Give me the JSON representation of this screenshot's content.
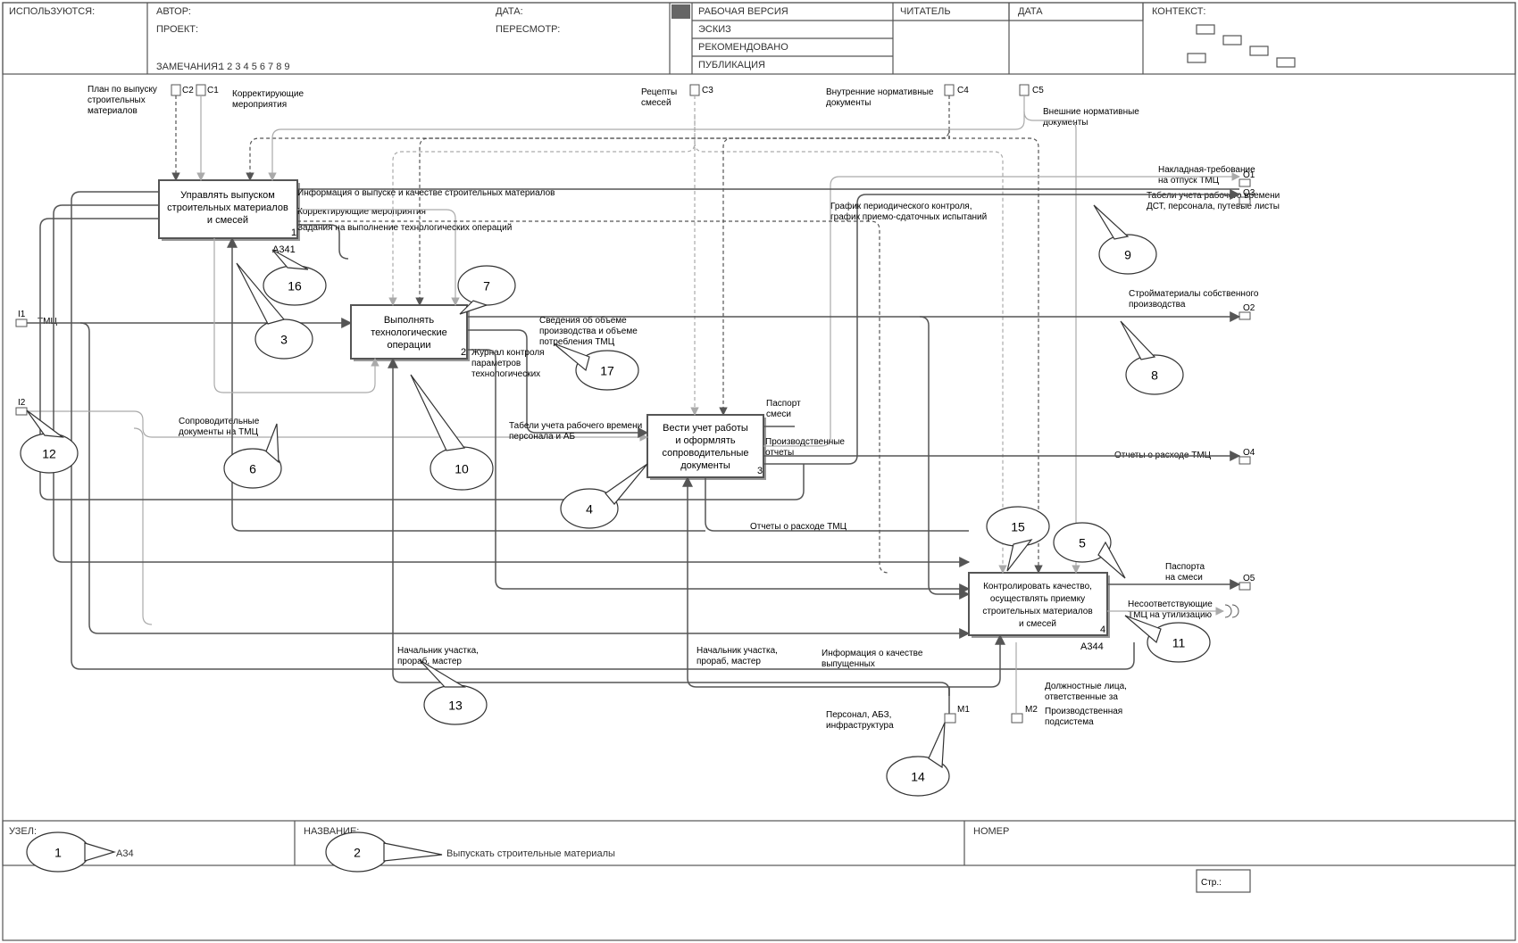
{
  "header": {
    "used": "ИСПОЛЬЗУЮТСЯ:",
    "author": "АВТОР:",
    "project": "ПРОЕКТ:",
    "date": "ДАТА:",
    "revision": "ПЕРЕСМОТР:",
    "notes": "ЗАМЕЧАНИЯ:",
    "noteNums": "1  2  3  4  5  6  7  8  9",
    "reader": "ЧИТАТЕЛЬ",
    "readerDate": "ДАТА",
    "context": "КОНТЕКСТ:",
    "rows": [
      "РАБОЧАЯ ВЕРСИЯ",
      "ЭСКИЗ",
      "РЕКОМЕНДОВАНО",
      "ПУБЛИКАЦИЯ"
    ]
  },
  "footer": {
    "node": "УЗЕЛ:",
    "nodeVal": "A34",
    "title": "НАЗВАНИЕ:",
    "titleVal": "Выпускать строительные материалы",
    "number": "НОМЕР",
    "page": "Стр.:"
  },
  "boxes": {
    "b1": {
      "l1": "Управлять выпуском",
      "l2": "строительных материалов",
      "l3": "и смесей",
      "num": "1",
      "code": "A341"
    },
    "b2": {
      "l1": "Выполнять",
      "l2": "технологические",
      "l3": "операции",
      "num": "2"
    },
    "b3": {
      "l1": "Вести учет работы",
      "l2": "и оформлять",
      "l3": "сопроводительные",
      "l4": "документы",
      "num": "3"
    },
    "b4": {
      "l1": "Контролировать качество,",
      "l2": "осуществлять приемку",
      "l3": "строительных материалов",
      "l4": "и смесей",
      "num": "4",
      "code": "A344"
    }
  },
  "controls": {
    "c1": "C1",
    "c2": "C2",
    "c3": "C3",
    "c4": "C4",
    "c5": "C5",
    "c1t": "Корректирующие",
    "c1t2": "мероприятия",
    "c2t": "План по выпуску",
    "c2t2": "строительных",
    "c2t3": "материалов",
    "c3t": "Рецепты",
    "c3t2": "смесей",
    "c4t": "Внутренние нормативные",
    "c4t2": "документы",
    "c5t": "Внешние нормативные",
    "c5t2": "документы"
  },
  "inputs": {
    "i1": "I1",
    "i1t": "ТМЦ",
    "i2": "I2"
  },
  "outputs": {
    "o1": "O1",
    "o1t": "Накладная-требование",
    "o1t2": "на отпуск ТМЦ",
    "o2": "O2",
    "o2t": "Стройматериалы собственного",
    "o2t2": "производства",
    "o3": "O3",
    "o3t": "Табели учета рабочего времени",
    "o3t2": "ДСТ, персонала, путевые листы",
    "o4": "O4",
    "o4t": "Отчеты о расходе ТМЦ",
    "o5": "O5",
    "o5t": "Паспорта",
    "o5t2": "на смеси"
  },
  "mech": {
    "m1": "M1",
    "m2": "M2",
    "m1t": "Персонал, АБЗ,",
    "m1t2": "инфраструктура",
    "m2t": "Должностные лица,",
    "m2t2": "ответственные за",
    "ps": "Производственная",
    "ps2": "подсистема"
  },
  "labels": {
    "l1": "Информация о выпуске и качестве строительных материалов",
    "l2": "Корректирующие мероприятия",
    "l3": "Задания на выполнение технологических операций",
    "l4": "Журнал контроля",
    "l4b": "параметров",
    "l4c": "технологических",
    "l5": "Сведения об объеме",
    "l5b": "производства и объеме",
    "l5c": "потребления ТМЦ",
    "l6": "Сопроводительные",
    "l6b": "документы на ТМЦ",
    "l7": "Табели учета рабочего времени",
    "l7b": "персонала и АБ",
    "l8": "Паспорт",
    "l8b": "смеси",
    "l9": "Производственные",
    "l9b": "отчеты",
    "l10": "Отчеты о расходе ТМЦ",
    "l11": "График периодического контроля,",
    "l11b": "график приемо-сдаточных испытаний",
    "l12": "Информация о качестве",
    "l12b": "выпущенных",
    "l13": "Начальник участка,",
    "l13b": "прораб, мастер",
    "l14": "Начальник участка,",
    "l14b": "прораб, мастер",
    "l15": "Несоответствующие",
    "l15b": "ТМЦ на утилизацию"
  },
  "callouts": {
    "c1": "1",
    "c2": "2",
    "c3": "3",
    "c4": "4",
    "c5": "5",
    "c6": "6",
    "c7": "7",
    "c8": "8",
    "c9": "9",
    "c10": "10",
    "c11": "11",
    "c12": "12",
    "c13": "13",
    "c14": "14",
    "c15": "15",
    "c16": "16",
    "c17": "17"
  }
}
